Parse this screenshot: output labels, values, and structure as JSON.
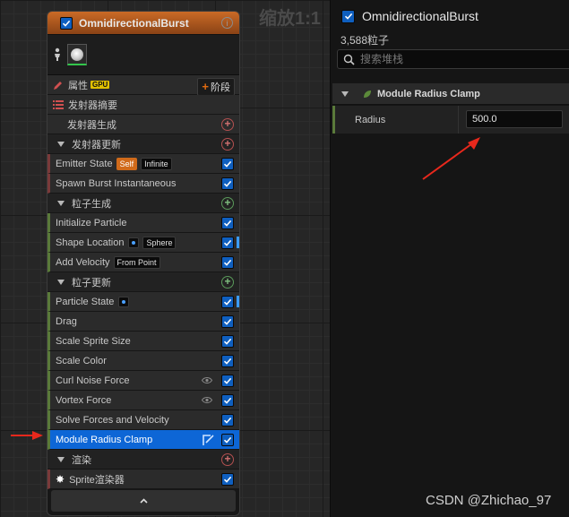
{
  "canvas": {
    "zoom_label": "缩放1:1"
  },
  "emitter": {
    "title": "OmnidirectionalBurst",
    "properties_row": {
      "label": "属性",
      "gpu_badge": "GPU",
      "stage_button": "阶段"
    },
    "rows": [
      {
        "type": "plain",
        "label": "发射器摘要"
      },
      {
        "type": "sub",
        "label": "发射器生成"
      },
      {
        "type": "section",
        "label": "发射器更新",
        "plus": "red"
      },
      {
        "type": "module",
        "label": "Emitter State",
        "border": "red",
        "badges": [
          {
            "text": "Self",
            "style": "orange"
          },
          {
            "text": "Infinite",
            "style": "dark"
          }
        ]
      },
      {
        "type": "module",
        "label": "Spawn Burst Instantaneous",
        "border": "red"
      },
      {
        "type": "section",
        "label": "粒子生成",
        "plus": "green"
      },
      {
        "type": "module",
        "label": "Initialize Particle",
        "border": "green"
      },
      {
        "type": "module",
        "label": "Shape Location",
        "border": "green",
        "dot": true,
        "badges": [
          {
            "text": "Sphere",
            "style": "dark"
          }
        ],
        "strip": true
      },
      {
        "type": "module",
        "label": "Add Velocity",
        "border": "green",
        "badges": [
          {
            "text": "From Point",
            "style": "dark"
          }
        ]
      },
      {
        "type": "section",
        "label": "粒子更新",
        "plus": "green"
      },
      {
        "type": "module",
        "label": "Particle State",
        "border": "green",
        "dot": true,
        "strip": true
      },
      {
        "type": "module",
        "label": "Drag",
        "border": "green"
      },
      {
        "type": "module",
        "label": "Scale Sprite Size",
        "border": "green"
      },
      {
        "type": "module",
        "label": "Scale Color",
        "border": "green"
      },
      {
        "type": "module",
        "label": "Curl Noise Force",
        "border": "green",
        "eye": true
      },
      {
        "type": "module",
        "label": "Vortex Force",
        "border": "green",
        "eye": true
      },
      {
        "type": "module",
        "label": "Solve Forces and Velocity",
        "border": "green"
      },
      {
        "type": "module",
        "label": "Module Radius Clamp",
        "border": "green",
        "selected": true
      },
      {
        "type": "section",
        "label": "渲染",
        "plus": "red"
      },
      {
        "type": "module",
        "label": "Sprite渲染器",
        "border": "red",
        "sprite_icon": true
      }
    ]
  },
  "details": {
    "emitter_name": "OmnidirectionalBurst",
    "particle_count": "3,588粒子",
    "search_placeholder": "搜索堆栈",
    "module_title": "Module Radius Clamp",
    "property_label": "Radius",
    "property_value": "500.0"
  },
  "watermark": "CSDN @Zhichao_97"
}
